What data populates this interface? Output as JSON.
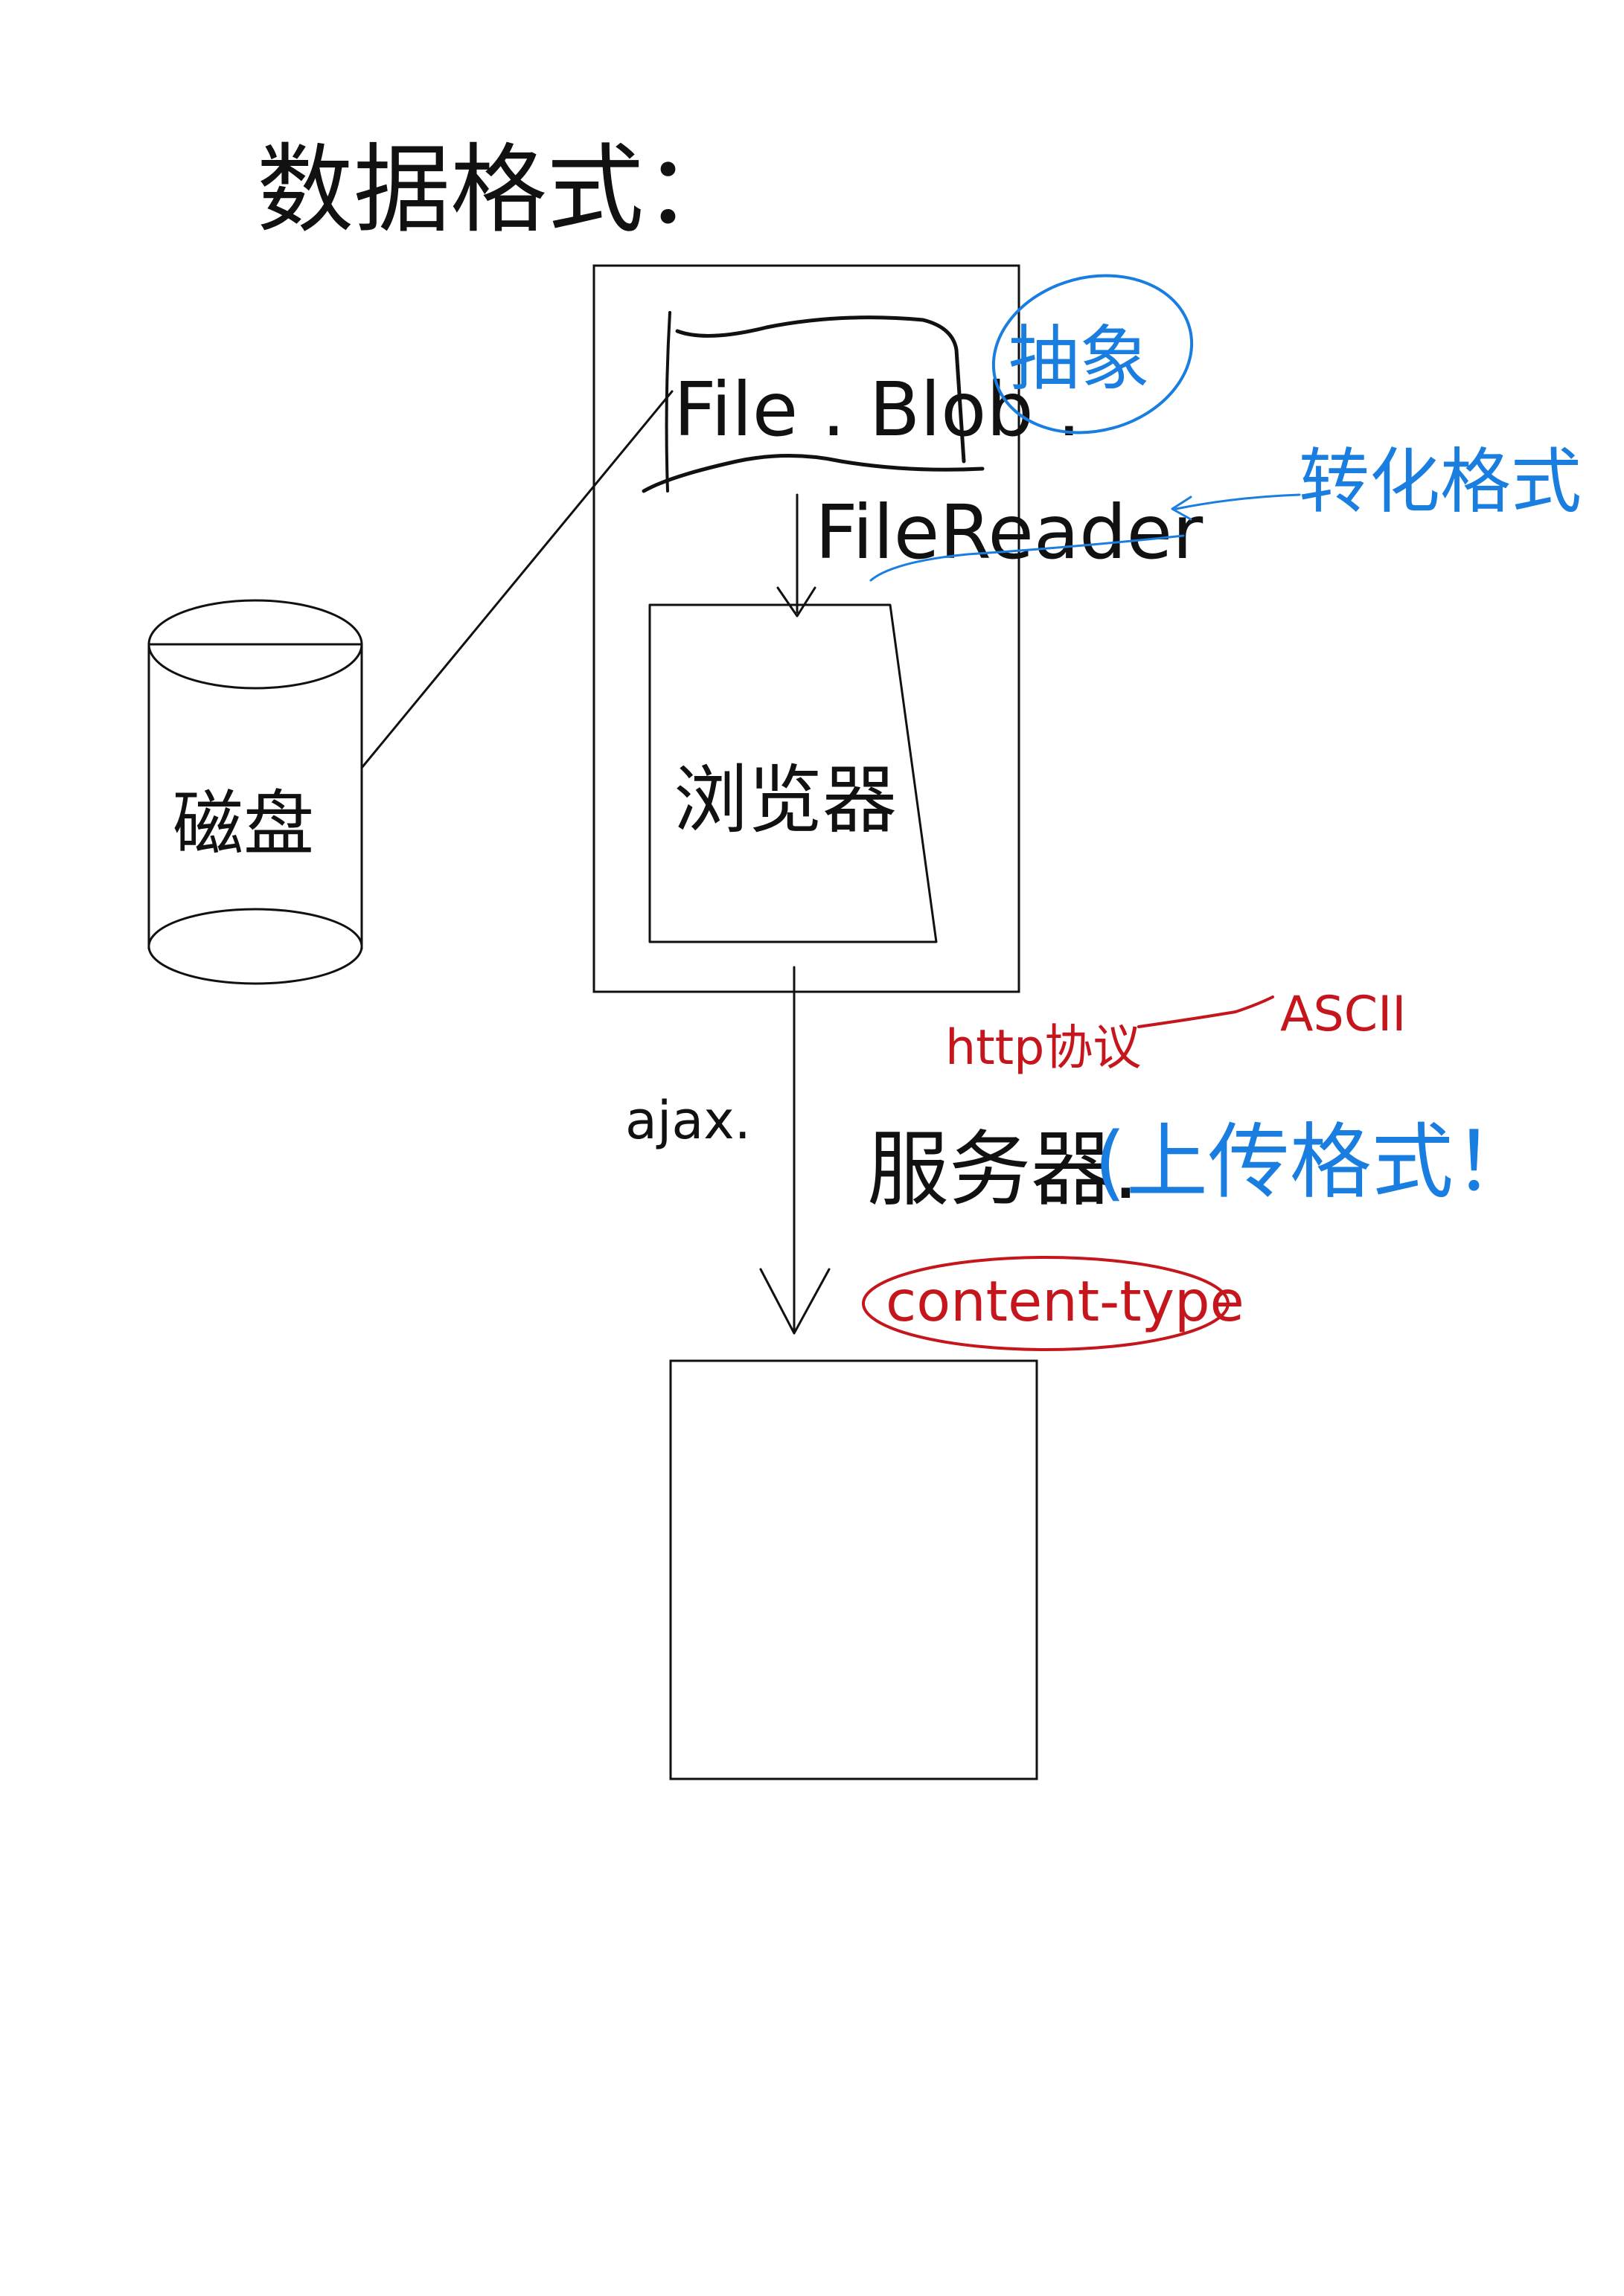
{
  "title": "数据格式：",
  "colors": {
    "ink": "#111111",
    "blue": "#1a7ee0",
    "red": "#c4161c",
    "background": "#ffffff"
  },
  "disk": {
    "label": "磁盘"
  },
  "browser_container": {
    "file_blob": {
      "label": "File . Blob ."
    },
    "abstract_note": {
      "label": "抽象"
    },
    "file_reader": {
      "label": "FileReader"
    },
    "convert_note": {
      "label": "转化格式"
    },
    "browser": {
      "label": "浏览器"
    }
  },
  "transport": {
    "ajax_label": "ajax.",
    "http_note": "http协议",
    "ascii_note": "ASCII",
    "server_label": "服务器.",
    "upload_format_note": "(上传格式！",
    "content_type_note": "content-type"
  }
}
